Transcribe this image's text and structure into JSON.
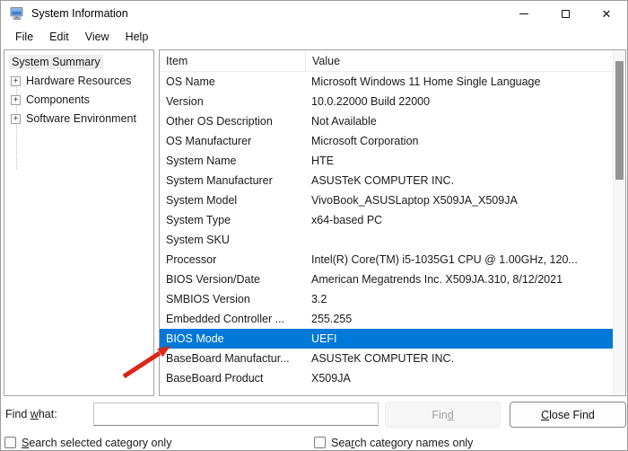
{
  "window": {
    "title": "System Information",
    "icons": {
      "close_glyph": "✕"
    }
  },
  "menu": {
    "items": [
      "File",
      "Edit",
      "View",
      "Help"
    ]
  },
  "sidebar": {
    "expand_glyph": "+",
    "items": [
      {
        "label": "System Summary",
        "selected": true,
        "expandable": false
      },
      {
        "label": "Hardware Resources",
        "expandable": true
      },
      {
        "label": "Components",
        "expandable": true
      },
      {
        "label": "Software Environment",
        "expandable": true
      }
    ]
  },
  "table": {
    "columns": {
      "item": "Item",
      "value": "Value"
    },
    "rows": [
      {
        "item": "OS Name",
        "value": "Microsoft Windows 11 Home Single Language"
      },
      {
        "item": "Version",
        "value": "10.0.22000 Build 22000"
      },
      {
        "item": "Other OS Description",
        "value": "Not Available"
      },
      {
        "item": "OS Manufacturer",
        "value": "Microsoft Corporation"
      },
      {
        "item": "System Name",
        "value": "HTE"
      },
      {
        "item": "System Manufacturer",
        "value": "ASUSTeK COMPUTER INC."
      },
      {
        "item": "System Model",
        "value": "VivoBook_ASUSLaptop X509JA_X509JA"
      },
      {
        "item": "System Type",
        "value": "x64-based PC"
      },
      {
        "item": "System SKU",
        "value": ""
      },
      {
        "item": "Processor",
        "value": "Intel(R) Core(TM) i5-1035G1 CPU @ 1.00GHz, 120..."
      },
      {
        "item": "BIOS Version/Date",
        "value": "American Megatrends Inc. X509JA.310, 8/12/2021"
      },
      {
        "item": "SMBIOS Version",
        "value": "3.2"
      },
      {
        "item": "Embedded Controller ...",
        "value": "255.255"
      },
      {
        "item": "BIOS Mode",
        "value": "UEFI",
        "highlighted": true
      },
      {
        "item": "BaseBoard Manufactur...",
        "value": "ASUSTeK COMPUTER INC."
      },
      {
        "item": "BaseBoard Product",
        "value": "X509JA"
      }
    ]
  },
  "find_bar": {
    "label_pre": "Find ",
    "label_mnemonic": "w",
    "label_post": "hat:",
    "input_value": "",
    "find_button": {
      "pre": "Fin",
      "mnemonic": "d",
      "post": ""
    },
    "close_button": {
      "pre": "",
      "mnemonic": "C",
      "post": "lose Find"
    }
  },
  "checkboxes": [
    {
      "pre": "",
      "mnemonic": "S",
      "post": "earch selected category only"
    },
    {
      "pre": "Sea",
      "mnemonic": "r",
      "post": "ch category names only"
    }
  ],
  "colors": {
    "selection": "#0078d7",
    "arrow": "#d92718"
  }
}
